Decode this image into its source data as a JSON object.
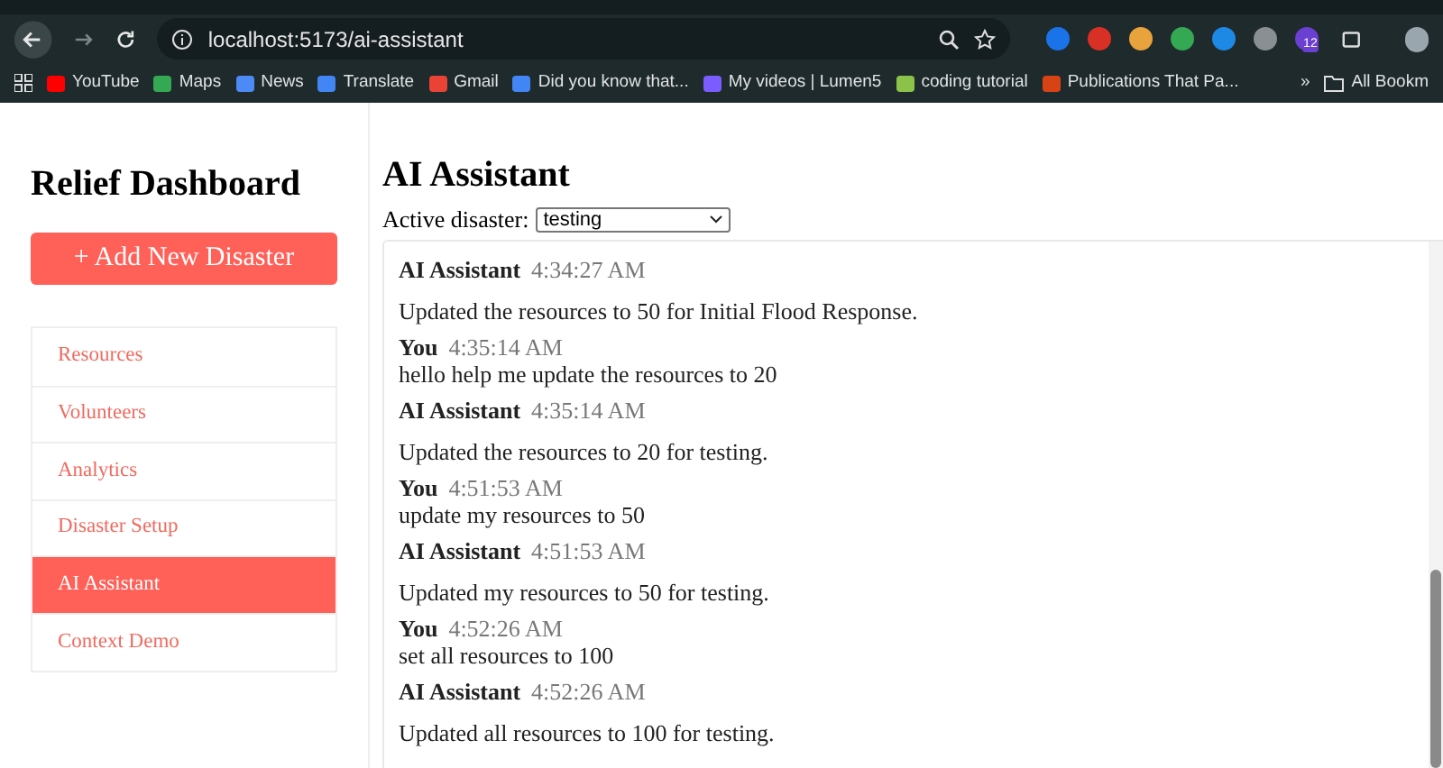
{
  "browser": {
    "url": "localhost:5173/ai-assistant",
    "extensions": [
      {
        "color": "#1a73e8"
      },
      {
        "color": "#d93025"
      },
      {
        "color": "#e8a33d"
      },
      {
        "color": "#34a853"
      },
      {
        "color": "#1e88e5"
      },
      {
        "color": "#8a8f94"
      },
      {
        "color": "#6a3fd1",
        "badge": "12"
      }
    ],
    "bookmarks": [
      {
        "label": "YouTube",
        "color": "#ff0000"
      },
      {
        "label": "Maps",
        "color": "#34a853"
      },
      {
        "label": "News",
        "color": "#4c8bf5"
      },
      {
        "label": "Translate",
        "color": "#4285f4"
      },
      {
        "label": "Gmail",
        "color": "#ea4335"
      },
      {
        "label": "Did you know that...",
        "color": "#4285f4"
      },
      {
        "label": "My videos | Lumen5",
        "color": "#7b5cff"
      },
      {
        "label": "coding tutorial",
        "color": "#8bc34a"
      },
      {
        "label": "Publications That Pa...",
        "color": "#d84315"
      }
    ],
    "overflow": "»",
    "all_bookmarks": "All Bookm"
  },
  "sidebar": {
    "title": "Relief Dashboard",
    "add_button": "+ Add New Disaster",
    "items": [
      {
        "label": "Resources",
        "selected": false
      },
      {
        "label": "Volunteers",
        "selected": false
      },
      {
        "label": "Analytics",
        "selected": false
      },
      {
        "label": "Disaster Setup",
        "selected": false
      },
      {
        "label": "AI Assistant",
        "selected": true
      },
      {
        "label": "Context Demo",
        "selected": false
      }
    ]
  },
  "main": {
    "title": "AI Assistant",
    "disaster_label": "Active disaster:",
    "disaster_value": "testing",
    "messages": [
      {
        "kind": "assistant",
        "sender": "AI Assistant",
        "time": "4:34:27 AM",
        "text": "Updated the resources to 50 for Initial Flood Response."
      },
      {
        "kind": "user",
        "sender": "You",
        "time": "4:35:14 AM",
        "text": "hello help me update the resources to 20"
      },
      {
        "kind": "assistant",
        "sender": "AI Assistant",
        "time": "4:35:14 AM",
        "text": "Updated the resources to 20 for testing."
      },
      {
        "kind": "user",
        "sender": "You",
        "time": "4:51:53 AM",
        "text": "update my resources to 50"
      },
      {
        "kind": "assistant",
        "sender": "AI Assistant",
        "time": "4:51:53 AM",
        "text": "Updated my resources to 50 for testing."
      },
      {
        "kind": "user",
        "sender": "You",
        "time": "4:52:26 AM",
        "text": "set all resources to 100"
      },
      {
        "kind": "assistant",
        "sender": "AI Assistant",
        "time": "4:52:26 AM",
        "text": "Updated all resources to 100 for testing."
      }
    ]
  }
}
